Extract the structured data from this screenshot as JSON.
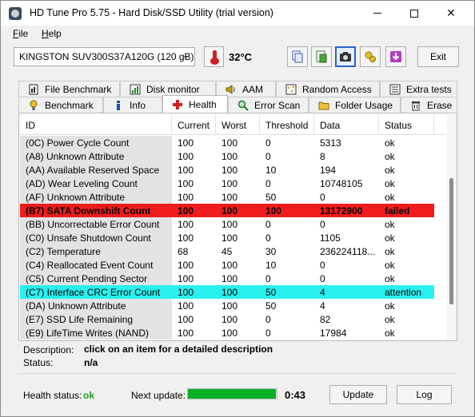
{
  "window": {
    "title": "HD Tune Pro 5.75 - Hard Disk/SSD Utility (trial version)"
  },
  "menu": [
    {
      "label": "File",
      "underline": "F"
    },
    {
      "label": "Help",
      "underline": "H"
    }
  ],
  "toolbar": {
    "drive": "KINGSTON SUV300S37A120G (120 gB)",
    "temperature": "32°C",
    "exit_label": "Exit",
    "icons": [
      "copy-icon",
      "info-doc-icon",
      "camera-icon",
      "gear-icon",
      "download-icon"
    ]
  },
  "tabs": {
    "row1": [
      {
        "label": "File Benchmark",
        "icon": "file-benchmark-icon"
      },
      {
        "label": "Disk monitor",
        "icon": "disk-monitor-icon"
      },
      {
        "label": "AAM",
        "icon": "speaker-icon"
      },
      {
        "label": "Random Access",
        "icon": "random-access-icon"
      },
      {
        "label": "Extra tests",
        "icon": "extra-tests-icon"
      }
    ],
    "row2": [
      {
        "label": "Benchmark",
        "icon": "benchmark-icon"
      },
      {
        "label": "Info",
        "icon": "info-icon"
      },
      {
        "label": "Health",
        "icon": "health-icon"
      },
      {
        "label": "Error Scan",
        "icon": "error-scan-icon"
      },
      {
        "label": "Folder Usage",
        "icon": "folder-icon"
      },
      {
        "label": "Erase",
        "icon": "erase-icon"
      }
    ],
    "active": "Health"
  },
  "table": {
    "columns": [
      "ID",
      "Current",
      "Worst",
      "Threshold",
      "Data",
      "Status"
    ],
    "rows": [
      {
        "id": "(0C) Power Cycle Count",
        "current": "100",
        "worst": "100",
        "threshold": "0",
        "data": "5313",
        "status": "ok",
        "state": "normal"
      },
      {
        "id": "(A8) Unknown Attribute",
        "current": "100",
        "worst": "100",
        "threshold": "0",
        "data": "8",
        "status": "ok",
        "state": "normal"
      },
      {
        "id": "(AA) Available Reserved Space",
        "current": "100",
        "worst": "100",
        "threshold": "10",
        "data": "194",
        "status": "ok",
        "state": "normal"
      },
      {
        "id": "(AD) Wear Leveling Count",
        "current": "100",
        "worst": "100",
        "threshold": "0",
        "data": "10748105",
        "status": "ok",
        "state": "normal"
      },
      {
        "id": "(AF) Unknown Attribute",
        "current": "100",
        "worst": "100",
        "threshold": "50",
        "data": "0",
        "status": "ok",
        "state": "normal"
      },
      {
        "id": "(B7) SATA Downshift Count",
        "current": "100",
        "worst": "100",
        "threshold": "100",
        "data": "13172900",
        "status": "failed",
        "state": "failed"
      },
      {
        "id": "(BB) Uncorrectable Error Count",
        "current": "100",
        "worst": "100",
        "threshold": "0",
        "data": "0",
        "status": "ok",
        "state": "normal"
      },
      {
        "id": "(C0) Unsafe Shutdown Count",
        "current": "100",
        "worst": "100",
        "threshold": "0",
        "data": "1105",
        "status": "ok",
        "state": "normal"
      },
      {
        "id": "(C2) Temperature",
        "current": "68",
        "worst": "45",
        "threshold": "30",
        "data": "236224118...",
        "status": "ok",
        "state": "normal"
      },
      {
        "id": "(C4) Reallocated Event Count",
        "current": "100",
        "worst": "100",
        "threshold": "10",
        "data": "0",
        "status": "ok",
        "state": "normal"
      },
      {
        "id": "(C5) Current Pending Sector",
        "current": "100",
        "worst": "100",
        "threshold": "0",
        "data": "0",
        "status": "ok",
        "state": "normal"
      },
      {
        "id": "(C7) Interface CRC Error Count",
        "current": "100",
        "worst": "100",
        "threshold": "50",
        "data": "4",
        "status": "attention",
        "state": "attention"
      },
      {
        "id": "(DA) Unknown Attribute",
        "current": "100",
        "worst": "100",
        "threshold": "50",
        "data": "4",
        "status": "ok",
        "state": "normal"
      },
      {
        "id": "(E7) SSD Life Remaining",
        "current": "100",
        "worst": "100",
        "threshold": "0",
        "data": "82",
        "status": "ok",
        "state": "normal"
      },
      {
        "id": "(E9) LifeTime Writes (NAND)",
        "current": "100",
        "worst": "100",
        "threshold": "0",
        "data": "17984",
        "status": "ok",
        "state": "normal"
      }
    ]
  },
  "details": {
    "description_label": "Description:",
    "description_value": "click on an item for a detailed description",
    "status_label": "Status:",
    "status_value": "n/a"
  },
  "footer": {
    "health_label": "Health status:",
    "health_value": "ok",
    "next_label": "Next update:",
    "progress_fraction": 0.99,
    "timer": "0:43",
    "update_label": "Update",
    "log_label": "Log"
  },
  "colors": {
    "failed": "#f21c1c",
    "attention": "#28f0ee",
    "ok_green": "#1e9a1e",
    "progress": "#06b025"
  }
}
